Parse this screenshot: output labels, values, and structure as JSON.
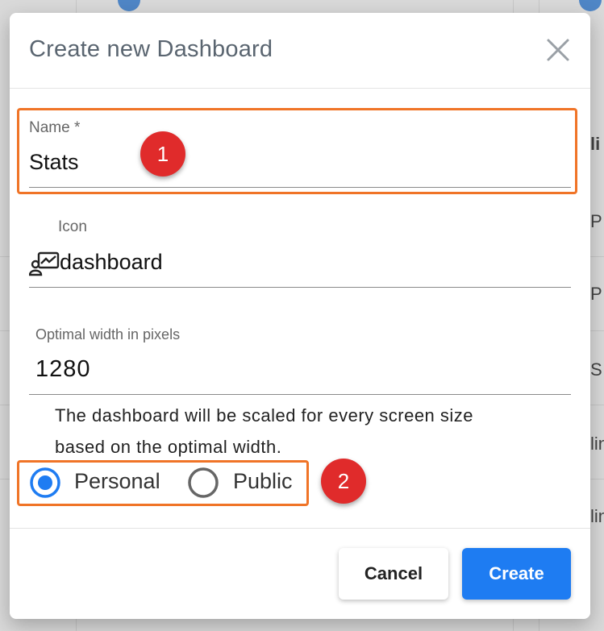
{
  "background": {
    "side_letters": [
      "li",
      "P",
      "P",
      "S",
      "lin",
      "lin"
    ]
  },
  "dialog": {
    "title": "Create new Dashboard",
    "close_icon": "close-icon"
  },
  "form": {
    "name": {
      "label": "Name *",
      "value": "Stats"
    },
    "icon": {
      "label": "Icon",
      "value": "dashboard",
      "icon_name": "dashboard-icon"
    },
    "width": {
      "label": "Optimal width in pixels",
      "value": "1280"
    },
    "help_line1": "The dashboard will be scaled for every screen size",
    "help_line2": "based on the optimal width.",
    "visibility": {
      "options": [
        {
          "label": "Personal",
          "selected": true
        },
        {
          "label": "Public",
          "selected": false
        }
      ]
    }
  },
  "annotations": {
    "badge1": "1",
    "badge2": "2",
    "highlight_color": "#f07427",
    "badge_color": "#e02b2b"
  },
  "buttons": {
    "cancel": "Cancel",
    "create": "Create"
  },
  "colors": {
    "accent": "#1e7cf2"
  }
}
